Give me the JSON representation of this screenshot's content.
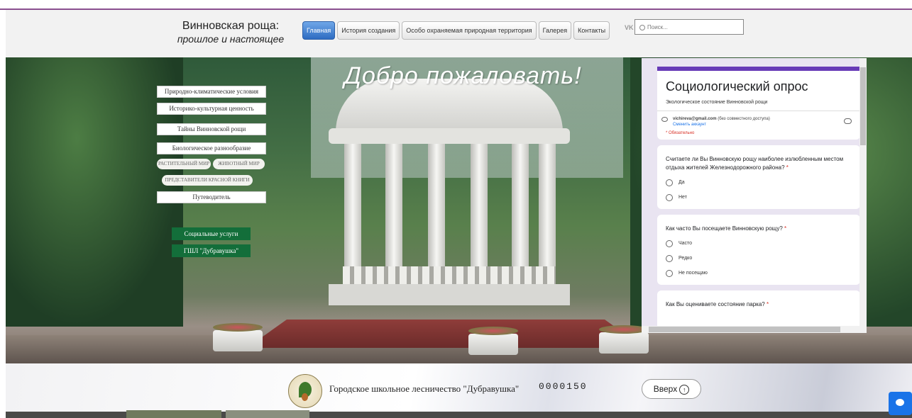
{
  "header": {
    "title_line1": "Винновская роща:",
    "title_line2": "прошлое и настоящее",
    "nav": [
      "Главная",
      "История создания",
      "Особо охраняемая природная территория",
      "Галерея",
      "Контакты"
    ],
    "active_nav": "Главная",
    "vk_label": "VK",
    "search_placeholder": "Поиск..."
  },
  "hero": {
    "welcome": "Добро пожаловать!"
  },
  "side_menu": {
    "items": [
      "Природно-климатические условия",
      "Историко-культурная ценность",
      "Тайны Винновской рощи",
      "Биологическое разнообразие"
    ],
    "sub_items": [
      "РАСТИТЕЛЬНЫЙ МИР",
      "ЖИВОТНЫЙ МИР",
      "ПРЕДСТАВИТЕЛИ КРАСНОЙ КНИГИ"
    ],
    "guide": "Путеводитель",
    "green_buttons": [
      "Социальные услуги",
      "ГШЛ \"Дубравушка\""
    ]
  },
  "survey": {
    "title": "Социологический опрос",
    "subtitle": "Экологическое состояние Винновской рощи",
    "email": "vichireva@gmail.com",
    "email_note": "(без совместного доступа)",
    "switch_account": "Сменить аккаунт",
    "required_note": "* Обязательно",
    "questions": [
      {
        "text": "Считаете ли Вы Винновскую рощу наиболее излюбленным местом отдыха жителей Железнодорожного района?",
        "options": [
          "Да",
          "Нет"
        ]
      },
      {
        "text": "Как часто Вы посещаете Винновскую рощу?",
        "options": [
          "Часто",
          "Редко",
          "Не посещаю"
        ]
      },
      {
        "text": "Как Вы оцениваете состояние парка?",
        "options": []
      }
    ],
    "required_star": "*"
  },
  "footer": {
    "org_name": "Городское школьное лесничество \"Дубравушка\"",
    "counter": "0000150",
    "up_button": "Вверх"
  },
  "colors": {
    "accent": "#673ab7",
    "nav_active": "#2e6cc2",
    "green_button": "#136e3a",
    "chat": "#1a73e8"
  }
}
